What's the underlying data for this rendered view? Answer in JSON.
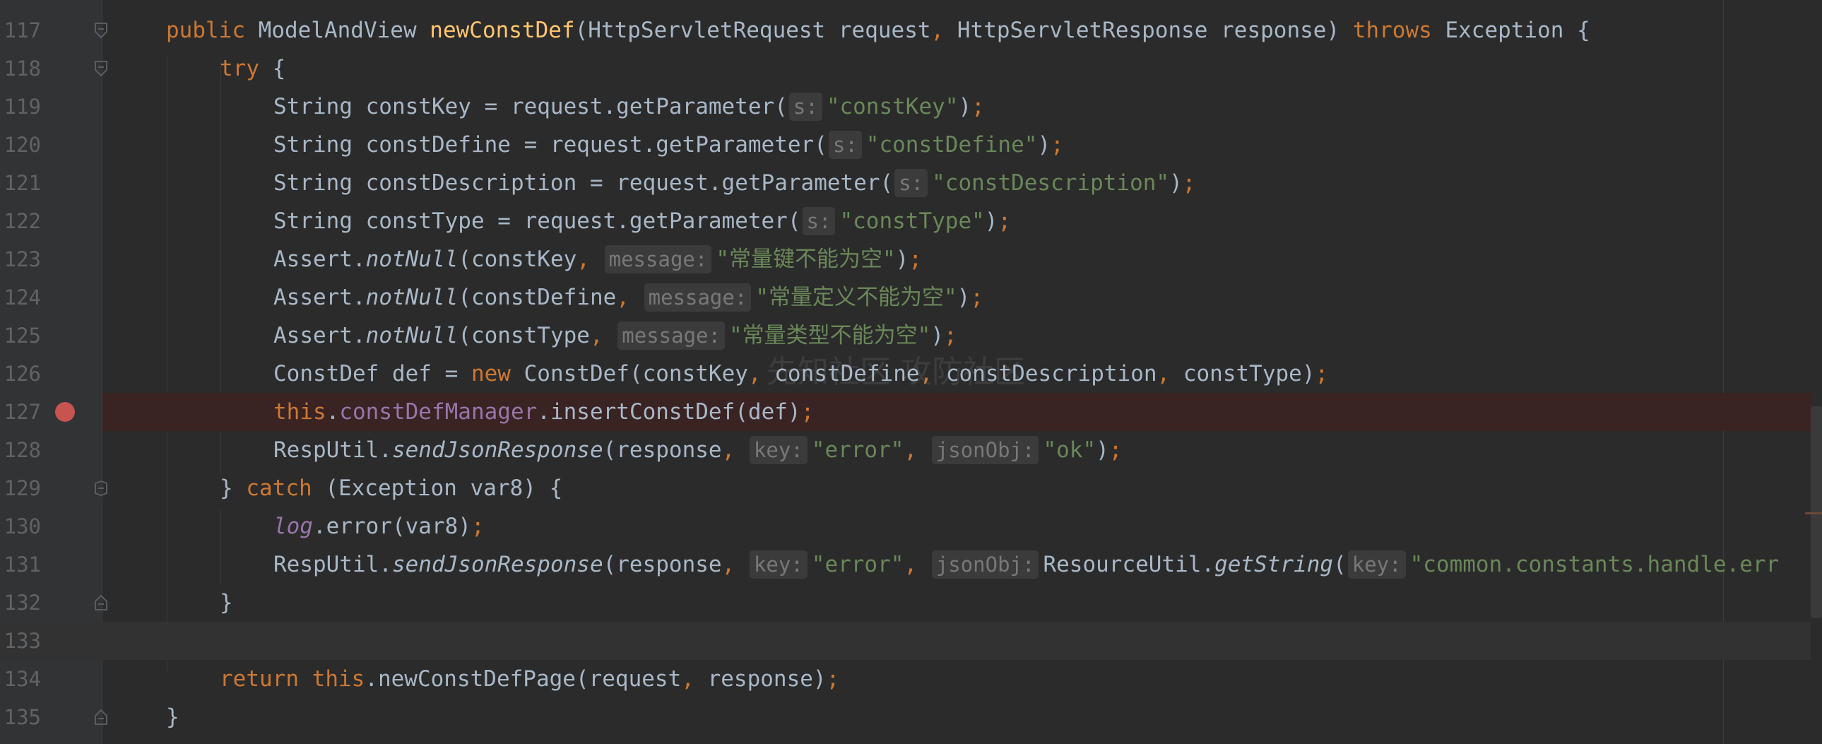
{
  "editor": {
    "watermark": "先知社区 攻防社区",
    "lines": [
      {
        "num": "117",
        "fold": "top"
      },
      {
        "num": "118",
        "fold": "top"
      },
      {
        "num": "119"
      },
      {
        "num": "120"
      },
      {
        "num": "121"
      },
      {
        "num": "122"
      },
      {
        "num": "123"
      },
      {
        "num": "124"
      },
      {
        "num": "125"
      },
      {
        "num": "126"
      },
      {
        "num": "127",
        "breakpoint": true
      },
      {
        "num": "128"
      },
      {
        "num": "129",
        "fold": "mid"
      },
      {
        "num": "130"
      },
      {
        "num": "131"
      },
      {
        "num": "132",
        "fold": "end"
      },
      {
        "num": "133",
        "current": true
      },
      {
        "num": "134"
      },
      {
        "num": "135",
        "fold": "end"
      }
    ],
    "tokens": {
      "l117": [
        "public",
        "ModelAndView",
        "newConstDef",
        "(HttpServletRequest request",
        ",",
        " HttpServletResponse response)",
        "throws",
        "Exception {"
      ],
      "l118": [
        "try",
        "{"
      ],
      "l119": [
        "String constKey = request.getParameter(",
        "s:",
        "\"constKey\"",
        ")",
        ";"
      ],
      "l120": [
        "String constDefine = request.getParameter(",
        "s:",
        "\"constDefine\"",
        ")",
        ";"
      ],
      "l121": [
        "String constDescription = request.getParameter(",
        "s:",
        "\"constDescription\"",
        ")",
        ";"
      ],
      "l122": [
        "String constType = request.getParameter(",
        "s:",
        "\"constType\"",
        ")",
        ";"
      ],
      "l123": [
        "Assert.",
        "notNull",
        "(constKey",
        ",",
        "message:",
        "\"常量键不能为空\"",
        ")",
        ";"
      ],
      "l124": [
        "Assert.",
        "notNull",
        "(constDefine",
        ",",
        "message:",
        "\"常量定义不能为空\"",
        ")",
        ";"
      ],
      "l125": [
        "Assert.",
        "notNull",
        "(constType",
        ",",
        "message:",
        "\"常量类型不能为空\"",
        ")",
        ";"
      ],
      "l126": [
        "ConstDef def = ",
        "new",
        " ConstDef(constKey",
        ",",
        " constDefine",
        ",",
        " constDescription",
        ",",
        " constType)",
        ";"
      ],
      "l127": [
        "this",
        ".",
        "constDefManager",
        ".insertConstDef(def)",
        ";"
      ],
      "l128": [
        "RespUtil.",
        "sendJsonResponse",
        "(response",
        ",",
        "key:",
        "\"error\"",
        ",",
        "jsonObj:",
        "\"ok\"",
        ")",
        ";"
      ],
      "l129": [
        "} ",
        "catch",
        " (Exception var8) {"
      ],
      "l130": [
        "log",
        ".error(var8)",
        ";"
      ],
      "l131": [
        "RespUtil.",
        "sendJsonResponse",
        "(response",
        ",",
        "key:",
        "\"error\"",
        ",",
        "jsonObj:",
        "ResourceUtil.",
        "getString",
        "(",
        "key:",
        "\"common.constants.handle.err"
      ],
      "l132": [
        "}"
      ],
      "l134": [
        "return",
        "this",
        ".newConstDefPage(request",
        ",",
        " response)",
        ";"
      ],
      "l135": [
        "}"
      ]
    }
  },
  "colors": {
    "background": "#2b2b2b",
    "keyword": "#cc7832",
    "method_decl": "#ffc66d",
    "string": "#6a8759",
    "field": "#9876aa",
    "breakpoint": "#c75450"
  }
}
